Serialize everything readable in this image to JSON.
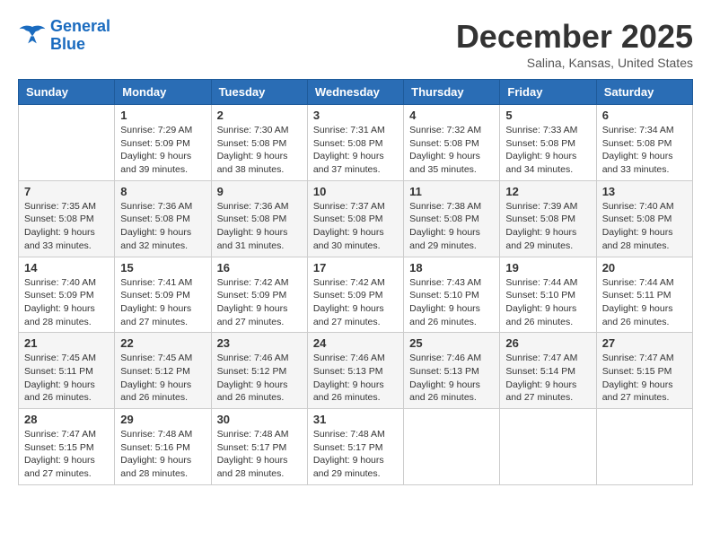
{
  "header": {
    "logo_line1": "General",
    "logo_line2": "Blue",
    "month": "December 2025",
    "location": "Salina, Kansas, United States"
  },
  "weekdays": [
    "Sunday",
    "Monday",
    "Tuesday",
    "Wednesday",
    "Thursday",
    "Friday",
    "Saturday"
  ],
  "weeks": [
    [
      {
        "day": "",
        "info": ""
      },
      {
        "day": "1",
        "info": "Sunrise: 7:29 AM\nSunset: 5:09 PM\nDaylight: 9 hours\nand 39 minutes."
      },
      {
        "day": "2",
        "info": "Sunrise: 7:30 AM\nSunset: 5:08 PM\nDaylight: 9 hours\nand 38 minutes."
      },
      {
        "day": "3",
        "info": "Sunrise: 7:31 AM\nSunset: 5:08 PM\nDaylight: 9 hours\nand 37 minutes."
      },
      {
        "day": "4",
        "info": "Sunrise: 7:32 AM\nSunset: 5:08 PM\nDaylight: 9 hours\nand 35 minutes."
      },
      {
        "day": "5",
        "info": "Sunrise: 7:33 AM\nSunset: 5:08 PM\nDaylight: 9 hours\nand 34 minutes."
      },
      {
        "day": "6",
        "info": "Sunrise: 7:34 AM\nSunset: 5:08 PM\nDaylight: 9 hours\nand 33 minutes."
      }
    ],
    [
      {
        "day": "7",
        "info": "Sunrise: 7:35 AM\nSunset: 5:08 PM\nDaylight: 9 hours\nand 33 minutes."
      },
      {
        "day": "8",
        "info": "Sunrise: 7:36 AM\nSunset: 5:08 PM\nDaylight: 9 hours\nand 32 minutes."
      },
      {
        "day": "9",
        "info": "Sunrise: 7:36 AM\nSunset: 5:08 PM\nDaylight: 9 hours\nand 31 minutes."
      },
      {
        "day": "10",
        "info": "Sunrise: 7:37 AM\nSunset: 5:08 PM\nDaylight: 9 hours\nand 30 minutes."
      },
      {
        "day": "11",
        "info": "Sunrise: 7:38 AM\nSunset: 5:08 PM\nDaylight: 9 hours\nand 29 minutes."
      },
      {
        "day": "12",
        "info": "Sunrise: 7:39 AM\nSunset: 5:08 PM\nDaylight: 9 hours\nand 29 minutes."
      },
      {
        "day": "13",
        "info": "Sunrise: 7:40 AM\nSunset: 5:08 PM\nDaylight: 9 hours\nand 28 minutes."
      }
    ],
    [
      {
        "day": "14",
        "info": "Sunrise: 7:40 AM\nSunset: 5:09 PM\nDaylight: 9 hours\nand 28 minutes."
      },
      {
        "day": "15",
        "info": "Sunrise: 7:41 AM\nSunset: 5:09 PM\nDaylight: 9 hours\nand 27 minutes."
      },
      {
        "day": "16",
        "info": "Sunrise: 7:42 AM\nSunset: 5:09 PM\nDaylight: 9 hours\nand 27 minutes."
      },
      {
        "day": "17",
        "info": "Sunrise: 7:42 AM\nSunset: 5:09 PM\nDaylight: 9 hours\nand 27 minutes."
      },
      {
        "day": "18",
        "info": "Sunrise: 7:43 AM\nSunset: 5:10 PM\nDaylight: 9 hours\nand 26 minutes."
      },
      {
        "day": "19",
        "info": "Sunrise: 7:44 AM\nSunset: 5:10 PM\nDaylight: 9 hours\nand 26 minutes."
      },
      {
        "day": "20",
        "info": "Sunrise: 7:44 AM\nSunset: 5:11 PM\nDaylight: 9 hours\nand 26 minutes."
      }
    ],
    [
      {
        "day": "21",
        "info": "Sunrise: 7:45 AM\nSunset: 5:11 PM\nDaylight: 9 hours\nand 26 minutes."
      },
      {
        "day": "22",
        "info": "Sunrise: 7:45 AM\nSunset: 5:12 PM\nDaylight: 9 hours\nand 26 minutes."
      },
      {
        "day": "23",
        "info": "Sunrise: 7:46 AM\nSunset: 5:12 PM\nDaylight: 9 hours\nand 26 minutes."
      },
      {
        "day": "24",
        "info": "Sunrise: 7:46 AM\nSunset: 5:13 PM\nDaylight: 9 hours\nand 26 minutes."
      },
      {
        "day": "25",
        "info": "Sunrise: 7:46 AM\nSunset: 5:13 PM\nDaylight: 9 hours\nand 26 minutes."
      },
      {
        "day": "26",
        "info": "Sunrise: 7:47 AM\nSunset: 5:14 PM\nDaylight: 9 hours\nand 27 minutes."
      },
      {
        "day": "27",
        "info": "Sunrise: 7:47 AM\nSunset: 5:15 PM\nDaylight: 9 hours\nand 27 minutes."
      }
    ],
    [
      {
        "day": "28",
        "info": "Sunrise: 7:47 AM\nSunset: 5:15 PM\nDaylight: 9 hours\nand 27 minutes."
      },
      {
        "day": "29",
        "info": "Sunrise: 7:48 AM\nSunset: 5:16 PM\nDaylight: 9 hours\nand 28 minutes."
      },
      {
        "day": "30",
        "info": "Sunrise: 7:48 AM\nSunset: 5:17 PM\nDaylight: 9 hours\nand 28 minutes."
      },
      {
        "day": "31",
        "info": "Sunrise: 7:48 AM\nSunset: 5:17 PM\nDaylight: 9 hours\nand 29 minutes."
      },
      {
        "day": "",
        "info": ""
      },
      {
        "day": "",
        "info": ""
      },
      {
        "day": "",
        "info": ""
      }
    ]
  ]
}
